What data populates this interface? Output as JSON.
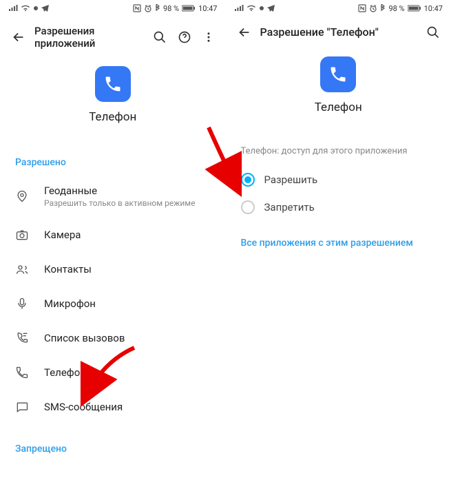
{
  "status": {
    "battery": "98 %",
    "time": "10:47"
  },
  "left": {
    "title": "Разрешения приложений",
    "app": {
      "name": "Телефон"
    },
    "allowed_label": "Разрешено",
    "denied_label": "Запрещено",
    "perms": [
      {
        "icon": "location",
        "title": "Геоданные",
        "sub": "Разрешить только в активном режиме"
      },
      {
        "icon": "camera",
        "title": "Камера",
        "sub": ""
      },
      {
        "icon": "contacts",
        "title": "Контакты",
        "sub": ""
      },
      {
        "icon": "mic",
        "title": "Микрофон",
        "sub": ""
      },
      {
        "icon": "calllog",
        "title": "Список вызовов",
        "sub": ""
      },
      {
        "icon": "phone",
        "title": "Телефон",
        "sub": ""
      },
      {
        "icon": "sms",
        "title": "SMS-сообщения",
        "sub": ""
      }
    ]
  },
  "right": {
    "title": "Разрешение \"Телефон\"",
    "app": {
      "name": "Телефон"
    },
    "caption": "Телефон: доступ для этого приложения",
    "options": [
      {
        "label": "Разрешить",
        "checked": true
      },
      {
        "label": "Запретить",
        "checked": false
      }
    ],
    "link": "Все приложения с этим разрешением"
  }
}
